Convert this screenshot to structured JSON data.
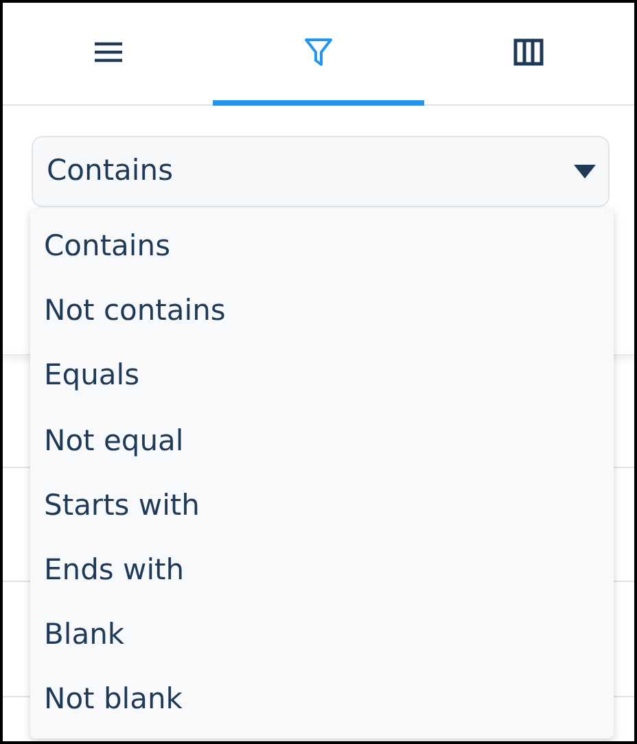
{
  "tabs": [
    {
      "kind": "menu",
      "selected": false
    },
    {
      "kind": "filter",
      "selected": true
    },
    {
      "kind": "columns",
      "selected": false
    }
  ],
  "filter": {
    "select": {
      "value": "Contains",
      "expanded": true
    },
    "options": [
      {
        "label": "Contains"
      },
      {
        "label": "Not contains"
      },
      {
        "label": "Equals"
      },
      {
        "label": "Not equal"
      },
      {
        "label": "Starts with"
      },
      {
        "label": "Ends with"
      },
      {
        "label": "Blank"
      },
      {
        "label": "Not blank"
      }
    ]
  }
}
